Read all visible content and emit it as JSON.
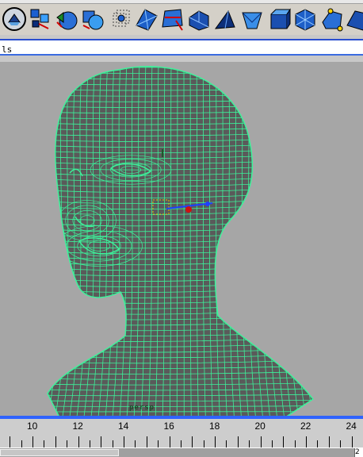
{
  "shelf": {
    "tools": [
      {
        "icon": "cube-create-icon"
      },
      {
        "icon": "component-mode-icon"
      },
      {
        "icon": "sphere-split-icon"
      },
      {
        "icon": "cube-sphere-icon"
      },
      {
        "icon": "wireframe-cube-icon"
      },
      {
        "icon": "extrude-face-icon"
      },
      {
        "icon": "split-polygon-icon"
      },
      {
        "icon": "bevel-face-icon"
      },
      {
        "icon": "wedge-face-icon"
      },
      {
        "icon": "append-polygon-icon"
      },
      {
        "icon": "poly-cube-icon"
      },
      {
        "icon": "subdivide-cube-icon"
      },
      {
        "icon": "smooth-poly-icon"
      }
    ]
  },
  "command_line": {
    "value": "ls"
  },
  "viewport": {
    "camera_label": "persp",
    "wire_color": "#3cf29a",
    "mesh_color": "#5a5a5a",
    "background": "#a6a6a6"
  },
  "time_slider": {
    "labels": [
      "10",
      "12",
      "14",
      "16",
      "18",
      "20",
      "22",
      "24"
    ],
    "end_label": "2"
  }
}
